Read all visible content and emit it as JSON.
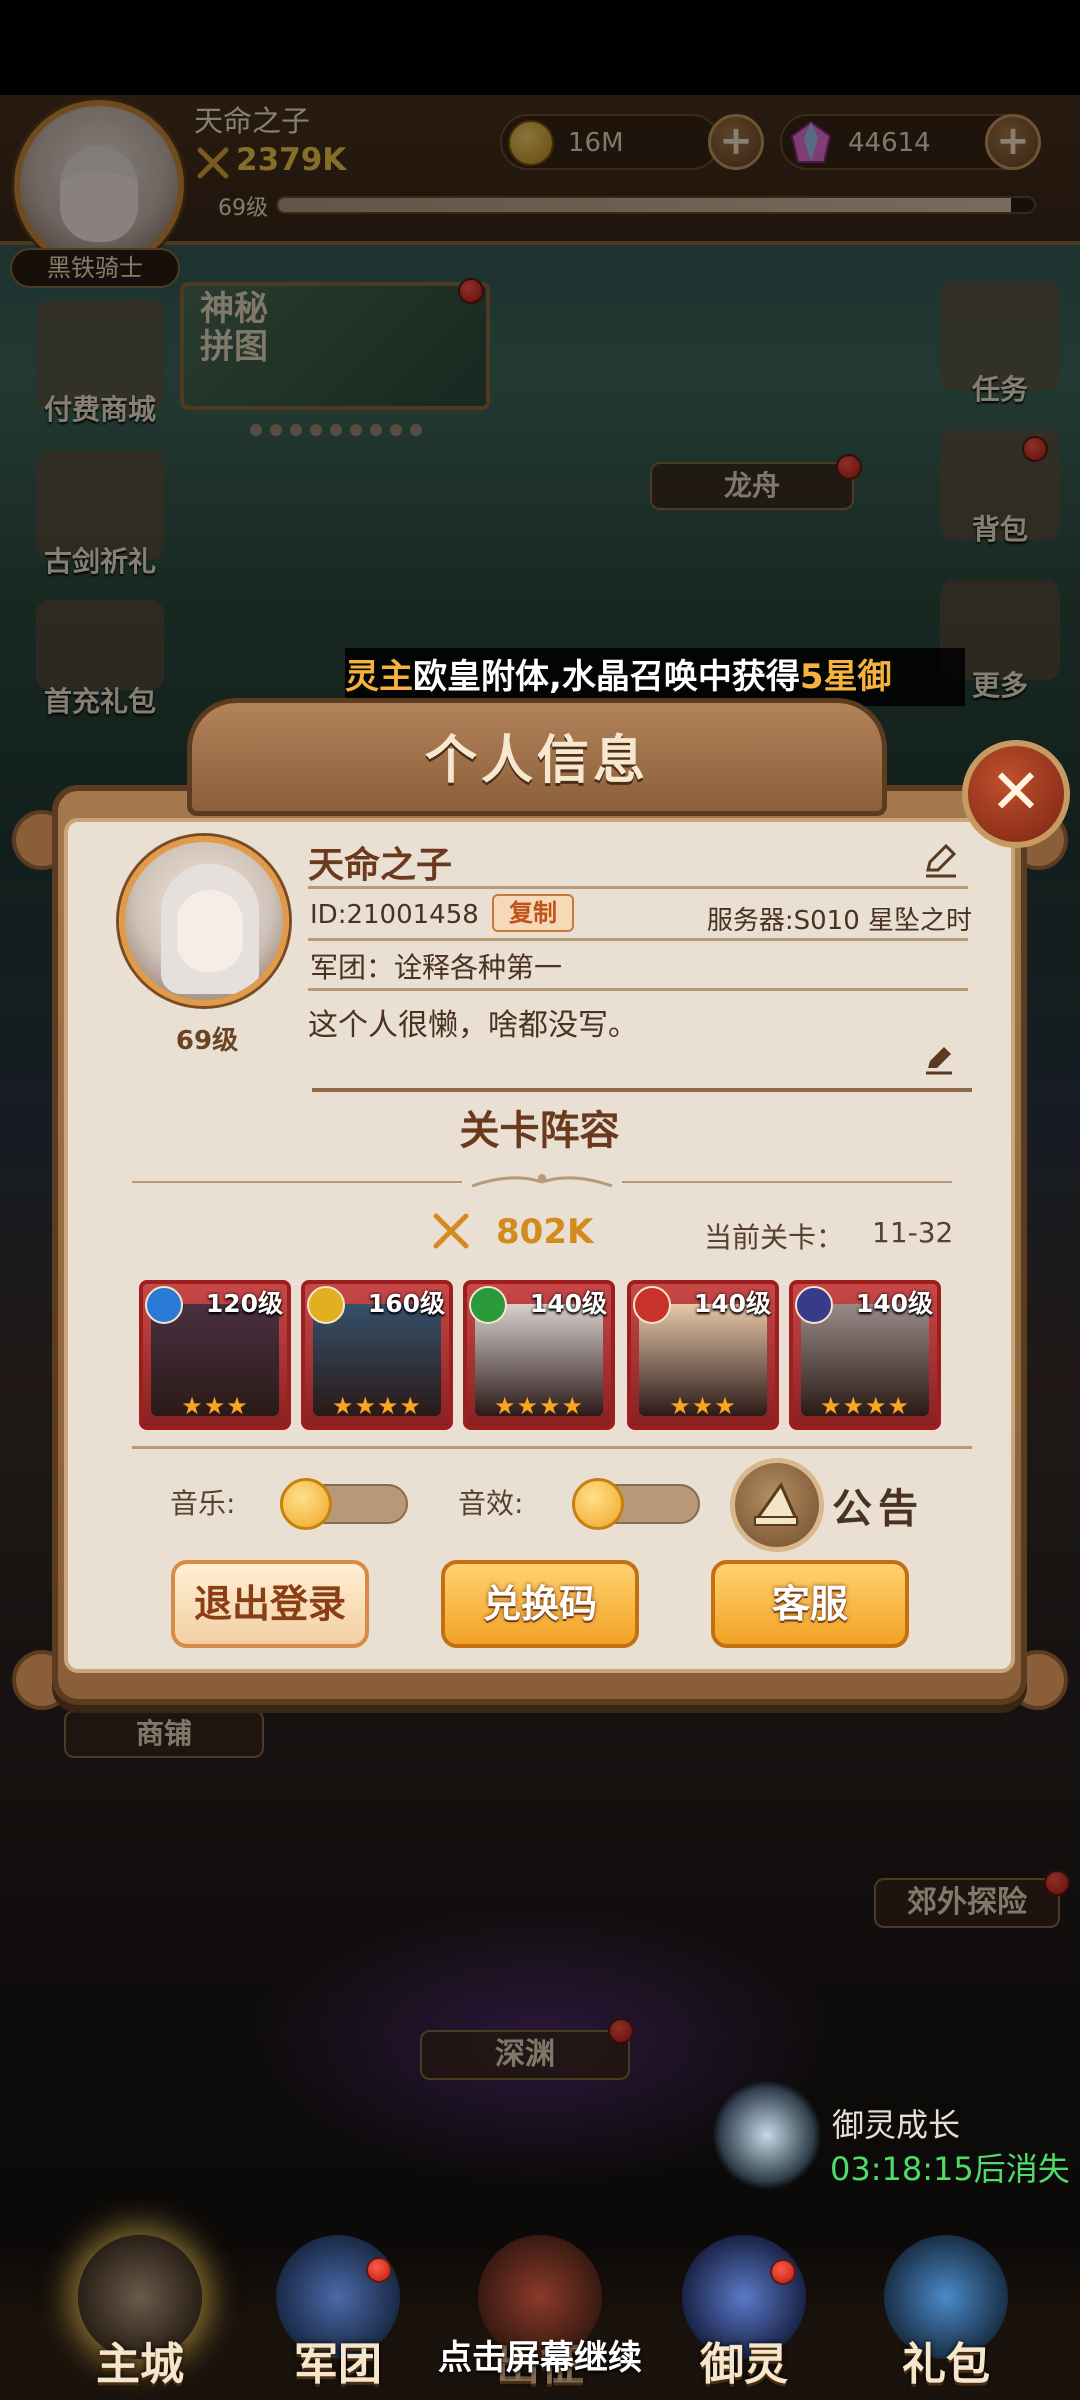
{
  "player": {
    "name": "天命之子",
    "power": "2379K",
    "level": "69级",
    "rank": "黑铁骑士",
    "xp_fraction": 0.97
  },
  "currency": {
    "gold": "16M",
    "gems": "44614"
  },
  "side_menu": {
    "left": [
      "付费商城",
      "古剑祈礼",
      "首充礼包"
    ],
    "right": [
      "任务",
      "背包",
      "更多"
    ],
    "puzzle": "神秘拼图",
    "dragon_boat": "龙舟"
  },
  "marquee": {
    "part1": "灵主",
    "part2": "欧皇附体,水晶召唤中获得",
    "part3": "5星御"
  },
  "dialog": {
    "title": "个人信息",
    "close": "✕",
    "profile": {
      "name": "天命之子",
      "level": "69级",
      "id": "ID:21001458",
      "copy": "复制",
      "server": "服务器:S010 星坠之时",
      "guild": "军团：诠释各种第一",
      "signature": "这个人很懒，啥都没写。"
    },
    "lineup_title": "关卡阵容",
    "lineup_power": "802K",
    "stage_label": "当前关卡：",
    "stage_value": "11-32",
    "heroes": [
      {
        "level": "120级",
        "stars": "★★★",
        "element_color": "#2a7ad8",
        "bg": "#4a3040"
      },
      {
        "level": "160级",
        "stars": "★★★★",
        "element_color": "#e0b020",
        "bg": "#35506a"
      },
      {
        "level": "140级",
        "stars": "★★★★",
        "element_color": "#2a9a3a",
        "bg": "#d8d0cc"
      },
      {
        "level": "140级",
        "stars": "★★★",
        "element_color": "#c8322a",
        "bg": "#e6c8a8"
      },
      {
        "level": "140级",
        "stars": "★★★★",
        "element_color": "#3a3a8a",
        "bg": "#9a8a88"
      }
    ],
    "music_label": "音乐:",
    "sfx_label": "音效:",
    "notice_label": "公告",
    "logout": "退出登录",
    "redeem": "兑换码",
    "support": "客服"
  },
  "world": {
    "shop": "商铺",
    "abyss": "深渊",
    "explore": "郊外探险",
    "growth_title": "御灵成长",
    "growth_timer": "03:18:15后消失"
  },
  "nav": [
    "主城",
    "军团",
    "出征",
    "御灵",
    "礼包"
  ],
  "tap_hint": "点击屏幕继续"
}
